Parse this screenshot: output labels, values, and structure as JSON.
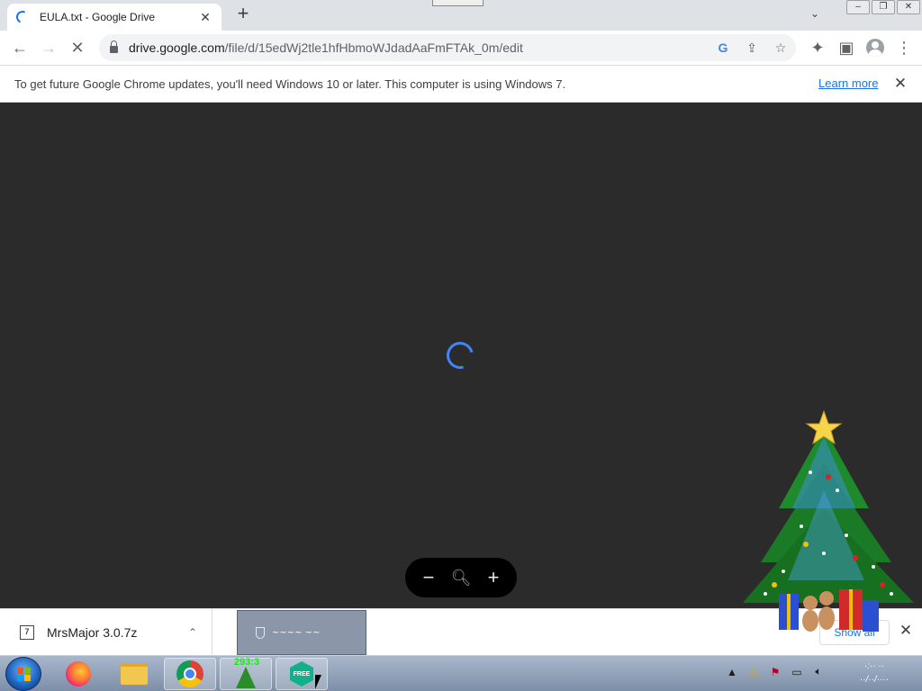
{
  "tab": {
    "title": "EULA.txt - Google Drive",
    "close": "✕",
    "new_tab": "+",
    "search": "⌄"
  },
  "window_controls": {
    "minimize": "–",
    "restore": "❐",
    "close": "✕"
  },
  "toolbar": {
    "back": "←",
    "forward": "→",
    "reload": "✕",
    "url_host": "drive.google.com",
    "url_path": "/file/d/15edWj2tle1hfHbmoWJdadAaFmFTAk_0m/edit",
    "google_icon": "G",
    "share_icon": "⇪",
    "star_icon": "☆",
    "extensions_icon": "✦",
    "sidepanel_icon": "▣",
    "menu_icon": "⋮"
  },
  "infobar": {
    "message": "To get future Google Chrome updates, you'll need Windows 10 or later. This computer is using Windows 7.",
    "learn_more": "Learn more",
    "close": "✕"
  },
  "viewer": {
    "zoom_out": "−",
    "zoom_reset": "🔍︎",
    "zoom_in": "+"
  },
  "download_shelf": {
    "file_icon_label": "7",
    "file_name": "MrsMajor 3.0.7z",
    "chevron": "⌃",
    "show_all": "Show all",
    "close": "✕"
  },
  "taskbar": {
    "tree_counter": "293:3",
    "hex_label": "FREE",
    "tray_icons": [
      "expand-icon",
      "shield-warning-icon",
      "flag-icon",
      "network-icon",
      "volume-icon"
    ],
    "tray_glyphs": [
      "▲",
      "⚠",
      "⚑",
      "▭",
      "🔈︎"
    ]
  },
  "colors": {
    "accent": "#1a73e8",
    "viewer_bg": "#2b2b2b",
    "tabstrip_bg": "#dee1e6"
  }
}
